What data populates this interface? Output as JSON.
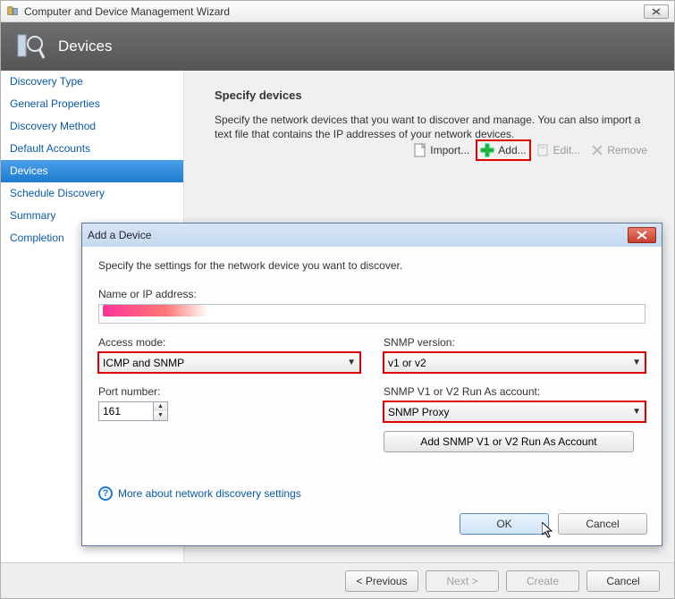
{
  "window": {
    "title": "Computer and Device Management Wizard"
  },
  "banner": {
    "title": "Devices"
  },
  "sidebar": {
    "items": [
      {
        "label": "Discovery Type"
      },
      {
        "label": "General Properties"
      },
      {
        "label": "Discovery Method"
      },
      {
        "label": "Default Accounts"
      },
      {
        "label": "Devices",
        "selected": true
      },
      {
        "label": "Schedule Discovery"
      },
      {
        "label": "Summary"
      },
      {
        "label": "Completion"
      }
    ]
  },
  "content": {
    "heading": "Specify devices",
    "description": "Specify the network devices that you want to discover and manage. You can also import a text file that contains the IP addresses of your network devices."
  },
  "toolbar": {
    "import": "Import...",
    "add": "Add...",
    "edit": "Edit...",
    "remove": "Remove"
  },
  "footer": {
    "previous": "< Previous",
    "next": "Next >",
    "create": "Create",
    "cancel": "Cancel"
  },
  "modal": {
    "title": "Add a Device",
    "intro": "Specify the settings for the network device you want to discover.",
    "name_label": "Name or IP address:",
    "name_value": "",
    "access_label": "Access mode:",
    "access_value": "ICMP and SNMP",
    "snmpver_label": "SNMP version:",
    "snmpver_value": "v1 or v2",
    "port_label": "Port number:",
    "port_value": "161",
    "runas_label": "SNMP V1 or V2 Run As account:",
    "runas_value": "SNMP Proxy",
    "addacct": "Add SNMP V1 or V2 Run As Account",
    "help": "More about network discovery settings",
    "ok": "OK",
    "cancel": "Cancel"
  }
}
